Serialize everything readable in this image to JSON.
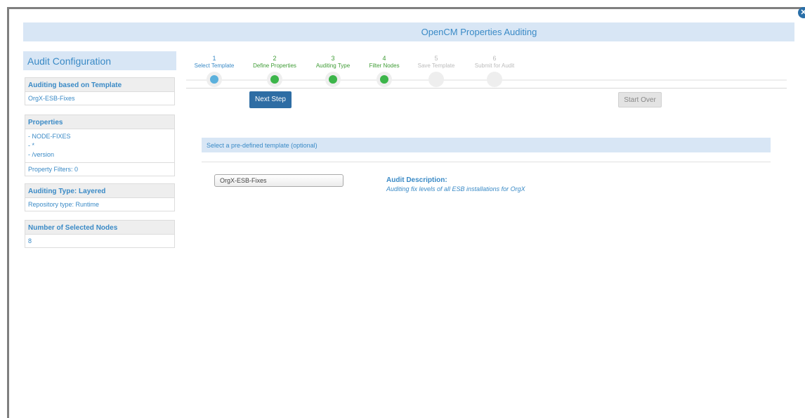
{
  "window": {
    "title": "OpenCM Properties Auditing",
    "close_icon": "close-icon"
  },
  "sidebar": {
    "header": "Audit Configuration",
    "template_panel": {
      "title": "Auditing based on Template",
      "value": "OrgX-ESB-Fixes"
    },
    "properties_panel": {
      "title": "Properties",
      "items": [
        "-  NODE-FIXES",
        "-  *",
        "-  /version"
      ],
      "filters": "Property Filters: 0"
    },
    "auditing_panel": {
      "title": "Auditing Type: Layered",
      "repository": "Repository type: Runtime"
    },
    "nodes_panel": {
      "title": "Number of Selected Nodes",
      "value": "8"
    }
  },
  "steps": [
    {
      "num": "1",
      "label": "Select Template",
      "state": "active"
    },
    {
      "num": "2",
      "label": "Define Properties",
      "state": "done"
    },
    {
      "num": "3",
      "label": "Auditing Type",
      "state": "done"
    },
    {
      "num": "4",
      "label": "Filter Nodes",
      "state": "done"
    },
    {
      "num": "5",
      "label": "Save Template",
      "state": "pending"
    },
    {
      "num": "6",
      "label": "Submit for Audit",
      "state": "pending"
    }
  ],
  "buttons": {
    "next": "Next Step",
    "start_over": "Start Over"
  },
  "template_section": {
    "title": "Select a pre-defined template (optional)",
    "selected": "OrgX-ESB-Fixes",
    "desc_label": "Audit Description:",
    "desc_text": "Auditing fix levels of all ESB installations for OrgX"
  },
  "colors": {
    "accent": "#3a8ac6",
    "active_dot": "#5bb0dc",
    "done_dot": "#3cb54a",
    "done_text": "#3f9c35",
    "pending_text": "#bbbbbb"
  }
}
